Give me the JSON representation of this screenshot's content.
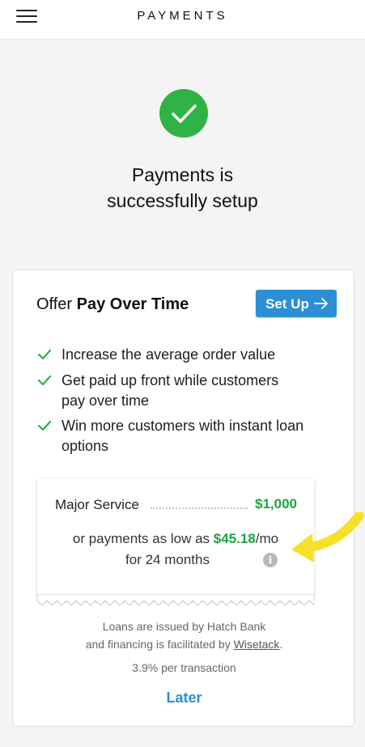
{
  "header": {
    "title": "PAYMENTS",
    "menu_icon": "hamburger-menu-icon"
  },
  "success": {
    "icon": "checkmark-circle-icon",
    "title_line1": "Payments is",
    "title_line2": "successfully setup",
    "color": "#2fb344"
  },
  "card": {
    "offer_prefix": "Offer ",
    "offer_bold": "Pay Over Time",
    "setup_button": "Set Up",
    "setup_icon": "arrow-right-icon",
    "accent_color": "#2b8fd6",
    "benefits": [
      {
        "line1": "Increase the average order value",
        "line2": ""
      },
      {
        "line1": "Get paid up front while customers",
        "line2": "pay over time"
      },
      {
        "line1": "Win more customers with instant loan",
        "line2": "options"
      }
    ],
    "receipt": {
      "service_label": "Major Service",
      "service_price": "$1,000",
      "payments_prefix": "or payments as low as ",
      "payments_amount": "$45.18",
      "payments_suffix": "/mo",
      "term": "for 24 months",
      "info_icon": "info-icon",
      "price_color": "#1fa33d"
    },
    "disclaimer_line1": "Loans are issued by Hatch Bank",
    "disclaimer_line2_prefix": "and financing is facilitated by ",
    "disclaimer_link": "Wisetack",
    "disclaimer_line2_suffix": ".",
    "fee_text": "3.9% per transaction",
    "later_link": "Later"
  },
  "annotation": {
    "icon": "yellow-arrow-icon",
    "color": "#f7e02a"
  }
}
